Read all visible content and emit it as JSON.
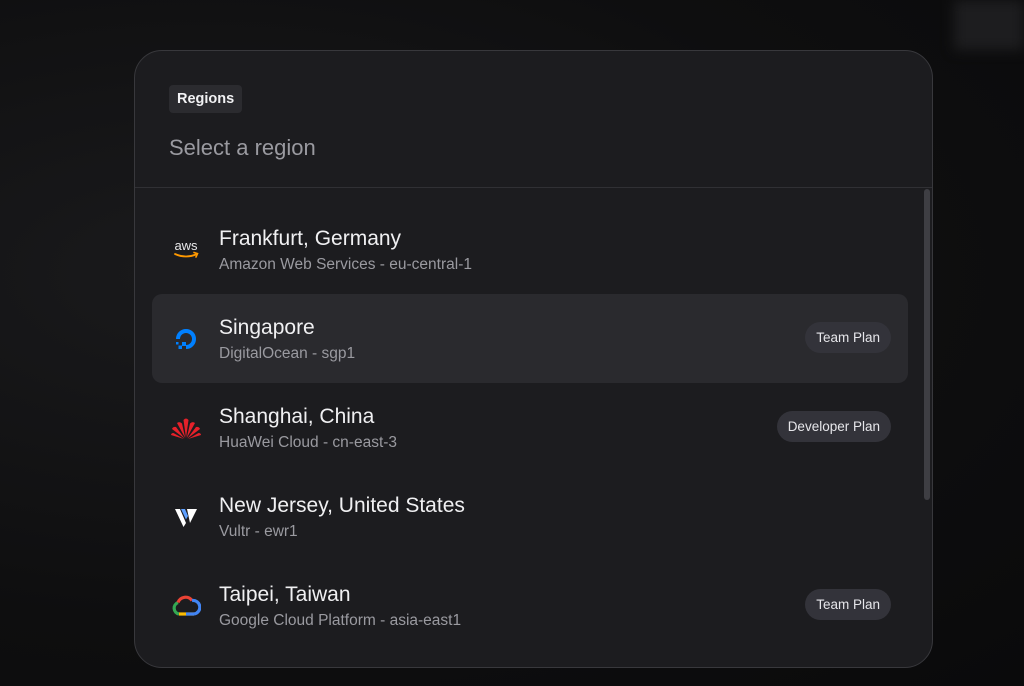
{
  "modal": {
    "tag_label": "Regions",
    "search_placeholder": "Select a region"
  },
  "regions": [
    {
      "city": "Frankfurt, Germany",
      "provider_line": "Amazon Web Services - eu-central-1",
      "logo": "aws-icon",
      "badge": ""
    },
    {
      "city": "Singapore",
      "provider_line": "DigitalOcean - sgp1",
      "logo": "digitalocean-icon",
      "badge": "Team Plan"
    },
    {
      "city": "Shanghai, China",
      "provider_line": "HuaWei Cloud - cn-east-3",
      "logo": "huawei-icon",
      "badge": "Developer Plan"
    },
    {
      "city": "New Jersey, United States",
      "provider_line": "Vultr - ewr1",
      "logo": "vultr-icon",
      "badge": ""
    },
    {
      "city": "Taipei, Taiwan",
      "provider_line": "Google Cloud Platform - asia-east1",
      "logo": "google-cloud-icon",
      "badge": "Team Plan"
    }
  ],
  "colors": {
    "aws_arrow": "#ff9900",
    "digitalocean": "#0080ff",
    "huawei": "#e6212a",
    "google_blue": "#4285f4",
    "google_red": "#ea4335",
    "google_yellow": "#fbbc05",
    "google_green": "#34a853"
  }
}
